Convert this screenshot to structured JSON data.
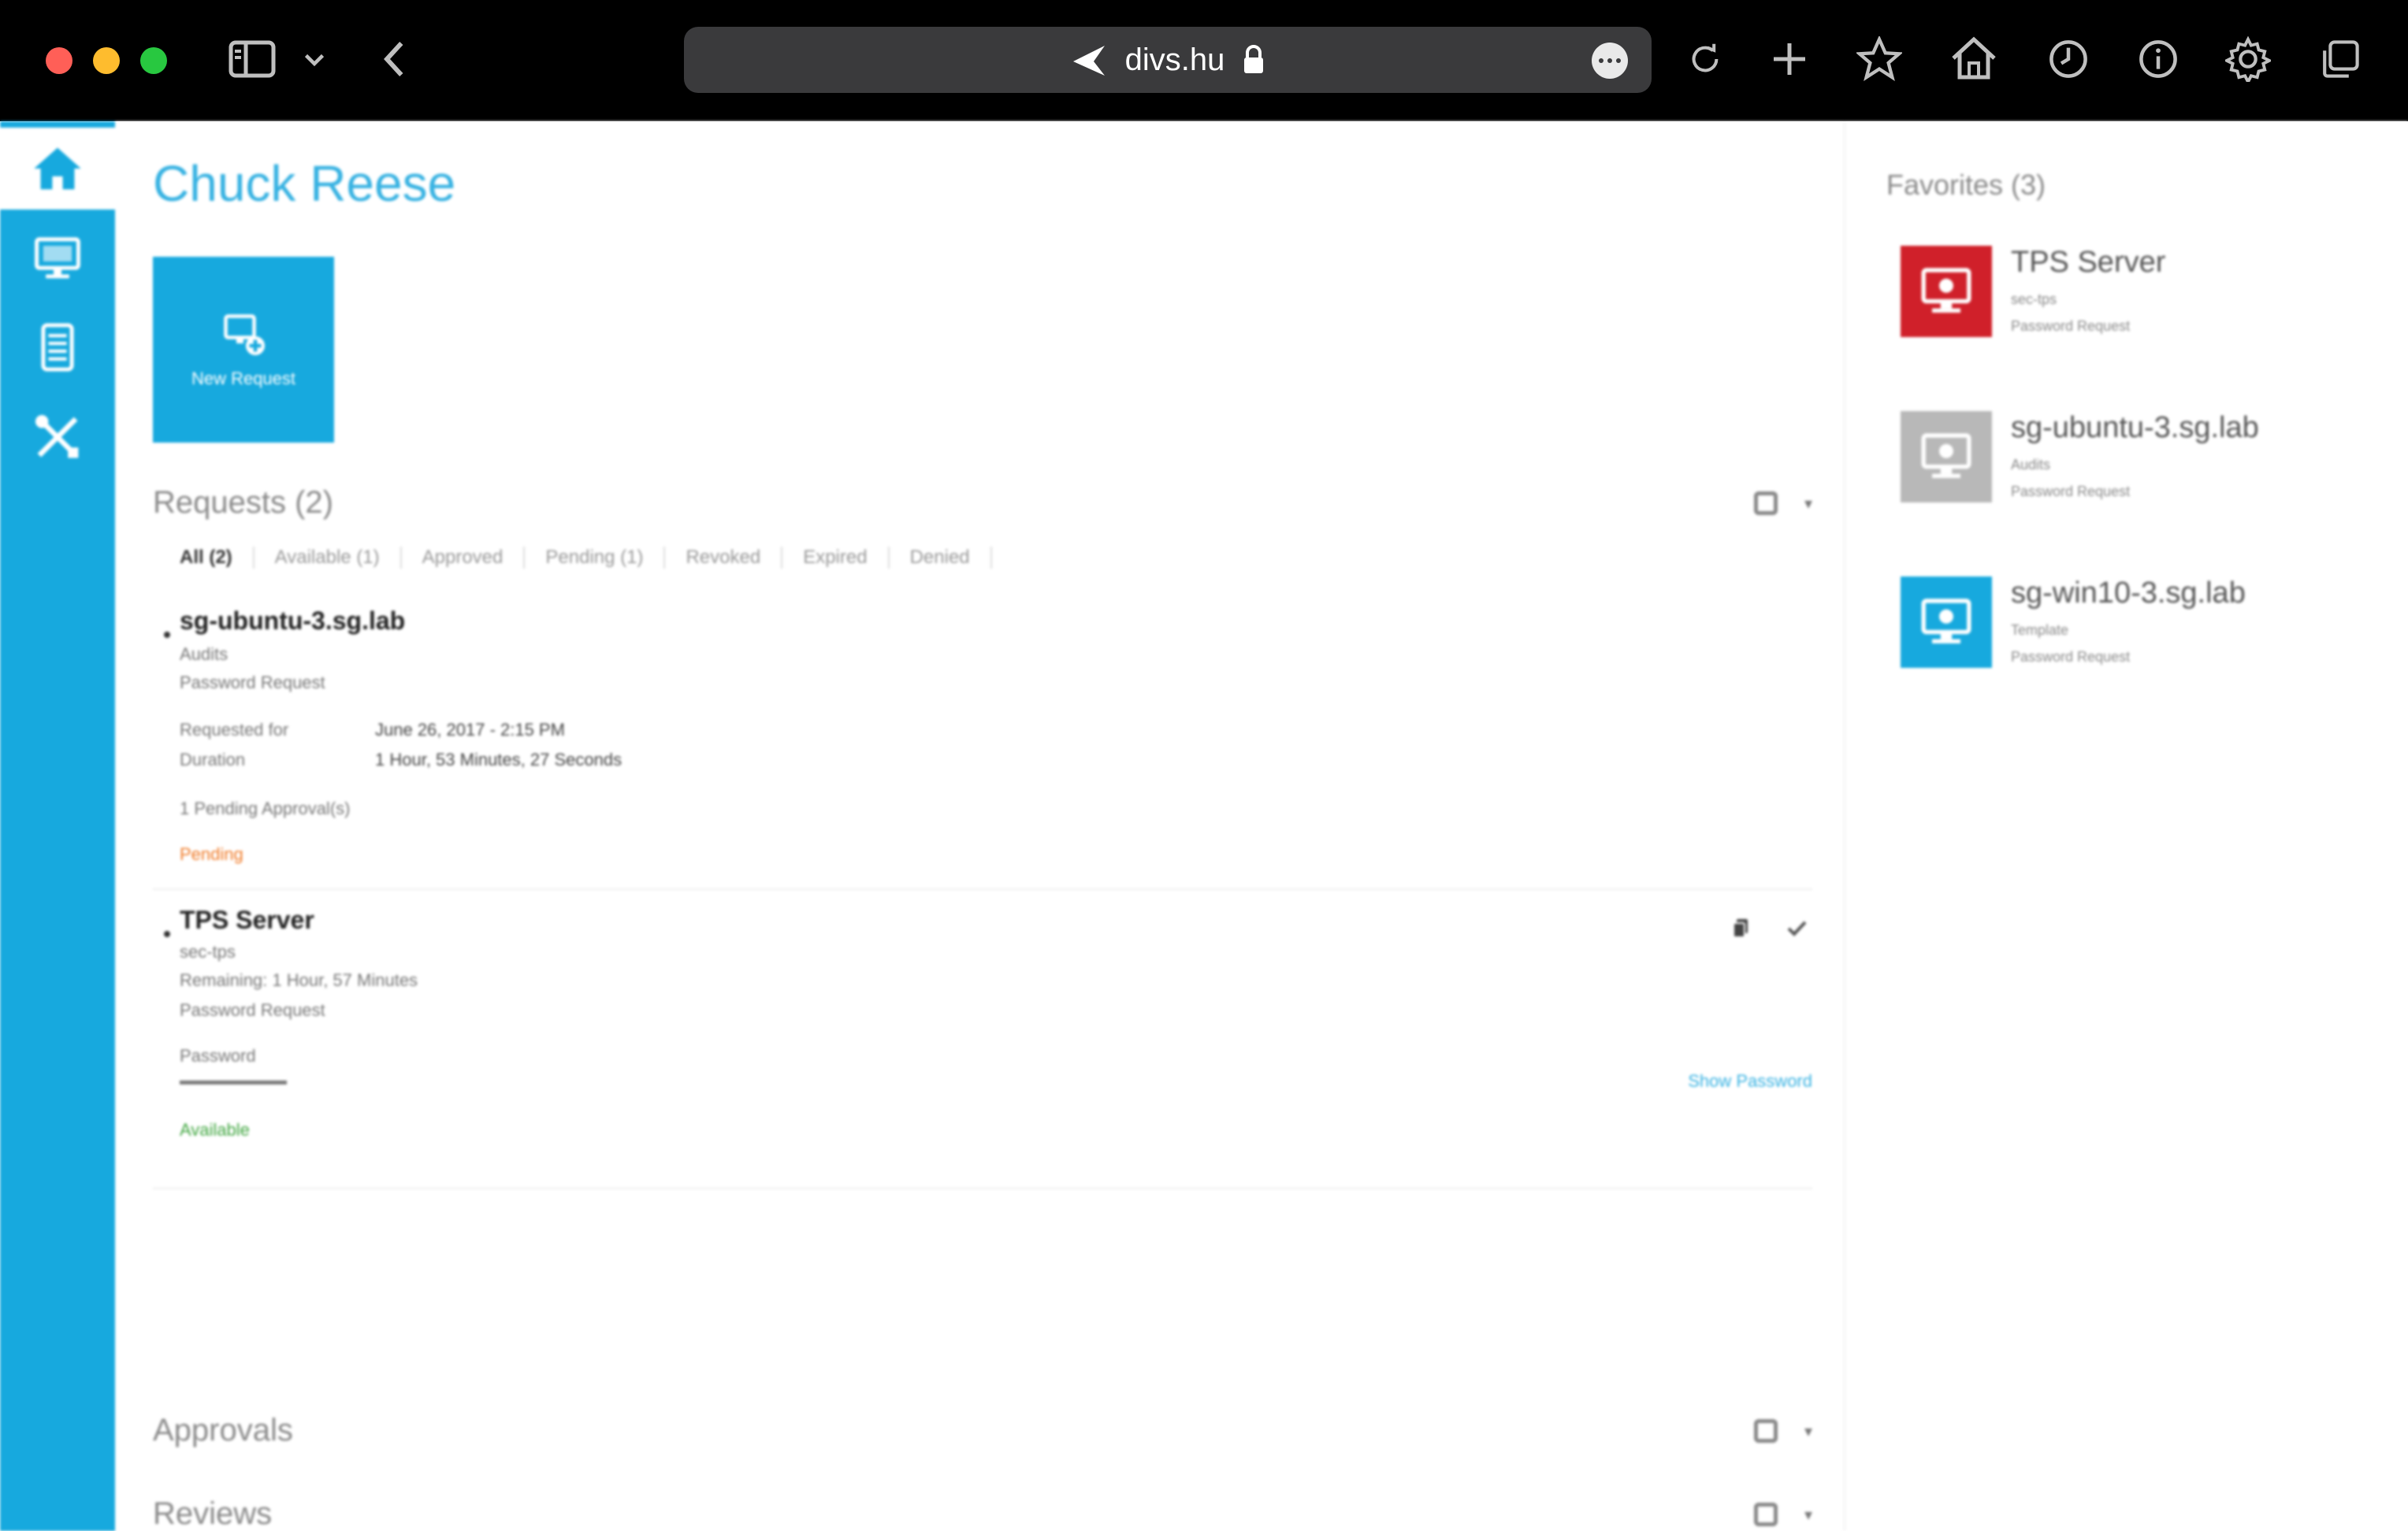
{
  "browser": {
    "url": "divs.hu",
    "icons": [
      "sidebar-icon",
      "chevron-down-icon",
      "back-icon",
      "lock-icon",
      "more-icon",
      "reload-icon",
      "new-tab-icon",
      "bookmark-star-icon",
      "home-icon",
      "history-icon",
      "info-icon",
      "settings-gear-icon",
      "tabs-overview-icon"
    ]
  },
  "sidebar": {
    "accent": "#17a9de",
    "items": [
      {
        "name": "home",
        "icon": "home-icon",
        "active": true
      },
      {
        "name": "remote-desktop",
        "icon": "desktop-icon",
        "active": false
      },
      {
        "name": "reports",
        "icon": "server-icon",
        "active": false
      },
      {
        "name": "tools",
        "icon": "tools-icon",
        "active": false
      }
    ]
  },
  "main": {
    "user_name": "Chuck Reese",
    "new_request_label": "New Request",
    "requests": {
      "title": "Requests (2)",
      "filters": [
        "All (2)",
        "Available (1)",
        "Approved",
        "Pending (1)",
        "Revoked",
        "Expired",
        "Denied"
      ],
      "items": [
        {
          "name": "sg-ubuntu-3.sg.lab",
          "subtitle": "Audits",
          "type": "Password Request",
          "requested_for_label": "Requested for",
          "requested_for": "June 26, 2017 - 2:15 PM",
          "duration_label": "Duration",
          "duration": "1 Hour, 53 Minutes, 27 Seconds",
          "approvals": "1 Pending Approval(s)",
          "status": "Pending"
        },
        {
          "name": "TPS Server",
          "subtitle": "sec-tps",
          "remaining": "Remaining: 1 Hour, 57 Minutes",
          "type": "Password Request",
          "password_label": "Password",
          "show_password": "Show Password",
          "status": "Available"
        }
      ]
    },
    "approvals_title": "Approvals",
    "reviews_title": "Reviews"
  },
  "favorites": {
    "title": "Favorites (3)",
    "items": [
      {
        "name": "TPS Server",
        "sub": "sec-tps",
        "type": "Password Request",
        "color": "#d0202a"
      },
      {
        "name": "sg-ubuntu-3.sg.lab",
        "sub": "Audits",
        "type": "Password Request",
        "color": "#b8b8b8"
      },
      {
        "name": "sg-win10-3.sg.lab",
        "sub": "Template",
        "type": "Password Request",
        "color": "#17a9de"
      }
    ]
  }
}
